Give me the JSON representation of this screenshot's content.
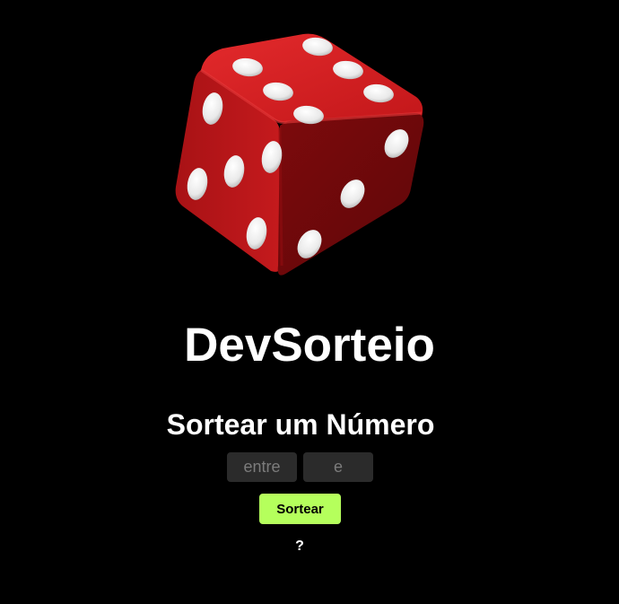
{
  "app": {
    "title": "DevSorteio",
    "subtitle": "Sortear um Número"
  },
  "form": {
    "min_placeholder": "entre",
    "max_placeholder": "e",
    "min_value": "",
    "max_value": "",
    "submit_label": "Sortear"
  },
  "help": {
    "label": "?"
  },
  "colors": {
    "background": "#000000",
    "accent": "#b5ff5c",
    "input_bg": "#2b2b2b",
    "dice_red": "#c8161a"
  },
  "icons": {
    "hero": "dice-icon"
  }
}
